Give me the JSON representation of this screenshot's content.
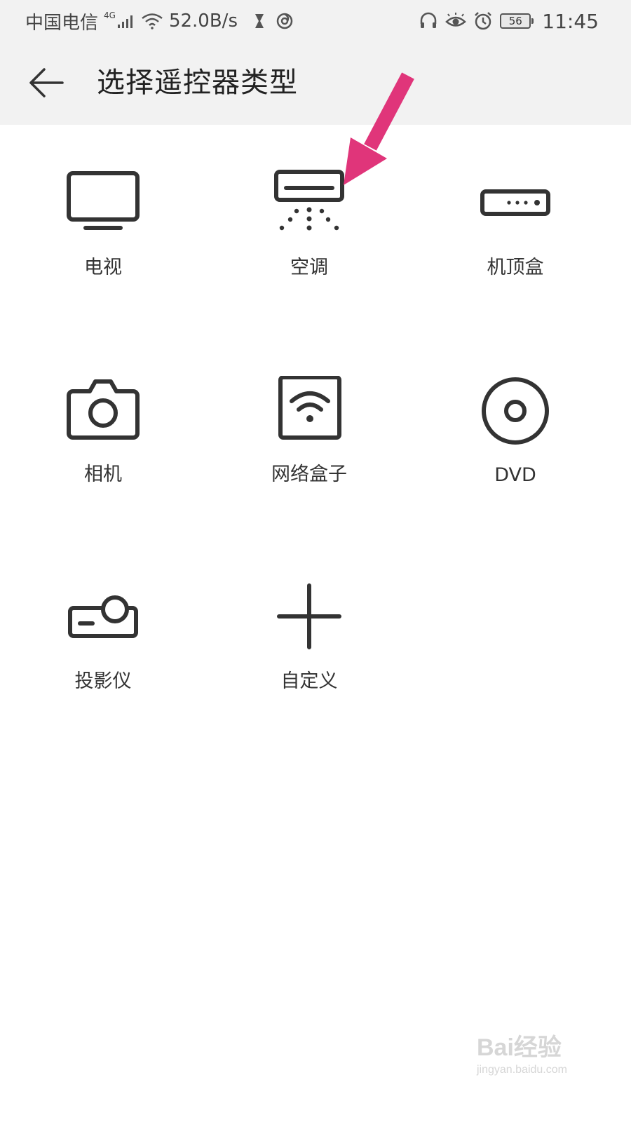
{
  "status_bar": {
    "carrier": "中国电信",
    "network_type": "4G",
    "speed": "52.0B/s",
    "battery": "56",
    "time": "11:45",
    "icons": [
      "signal-icon",
      "wifi-icon",
      "hourglass-icon",
      "app-notification-icon",
      "headset-icon",
      "eye-icon",
      "alarm-icon",
      "battery-icon"
    ]
  },
  "header": {
    "back_icon": "arrow-left-icon",
    "title": "选择遥控器类型"
  },
  "device_types": [
    {
      "label": "电视",
      "icon": "tv-icon"
    },
    {
      "label": "空调",
      "icon": "air-conditioner-icon"
    },
    {
      "label": "机顶盒",
      "icon": "set-top-box-icon"
    },
    {
      "label": "相机",
      "icon": "camera-icon"
    },
    {
      "label": "网络盒子",
      "icon": "network-box-icon"
    },
    {
      "label": "DVD",
      "icon": "dvd-icon"
    },
    {
      "label": "投影仪",
      "icon": "projector-icon"
    },
    {
      "label": "自定义",
      "icon": "plus-icon"
    }
  ],
  "annotation": {
    "color": "#e0357a",
    "icon": "pointer-arrow-icon"
  },
  "watermark": {
    "main": "Bai经验",
    "sub": "jingyan.baidu.com"
  },
  "colors": {
    "bar_bg": "#f2f2f2",
    "icon_stroke": "#333333"
  }
}
